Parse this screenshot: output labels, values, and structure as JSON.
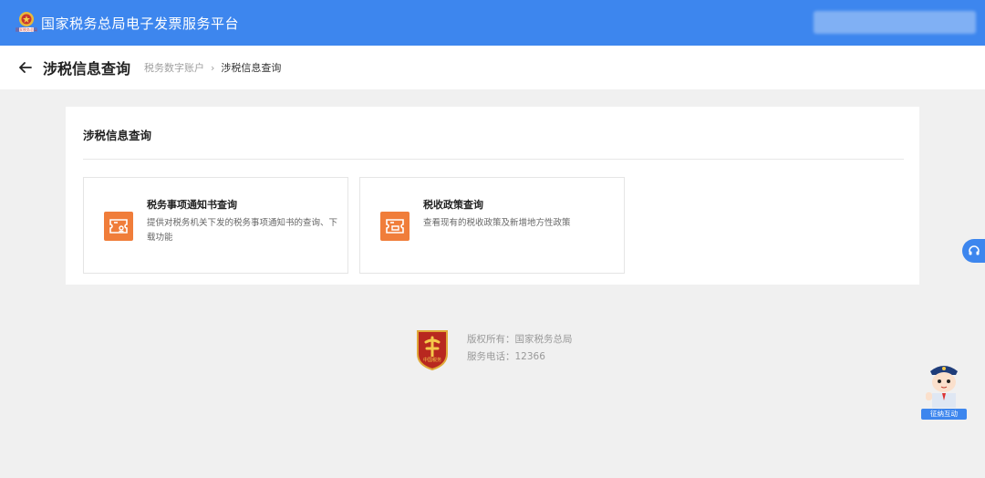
{
  "header": {
    "platform_title": "国家税务总局电子发票服务平台",
    "emblem_caption": "国家税务总局"
  },
  "subheader": {
    "page_title": "涉税信息查询",
    "breadcrumb": [
      "税务数字账户",
      "涉税信息查询"
    ]
  },
  "main": {
    "section_title": "涉税信息查询",
    "services": [
      {
        "title": "税务事项通知书查询",
        "description": "提供对税务机关下发的税务事项通知书的查询、下载功能",
        "icon": "document-stamp-icon"
      },
      {
        "title": "税收政策查询",
        "description": "查看现有的税收政策及新增地方性政策",
        "icon": "document-list-icon"
      }
    ]
  },
  "footer": {
    "logo_caption": "中国税务",
    "copyright": "版权所有：国家税务总局",
    "phone": "服务电话：12366"
  },
  "floating": {
    "support_label": "征纳互动"
  },
  "colors": {
    "accent": "#3d86ee",
    "icon_orange": "#f07d3a",
    "background": "#f0f0f0"
  }
}
